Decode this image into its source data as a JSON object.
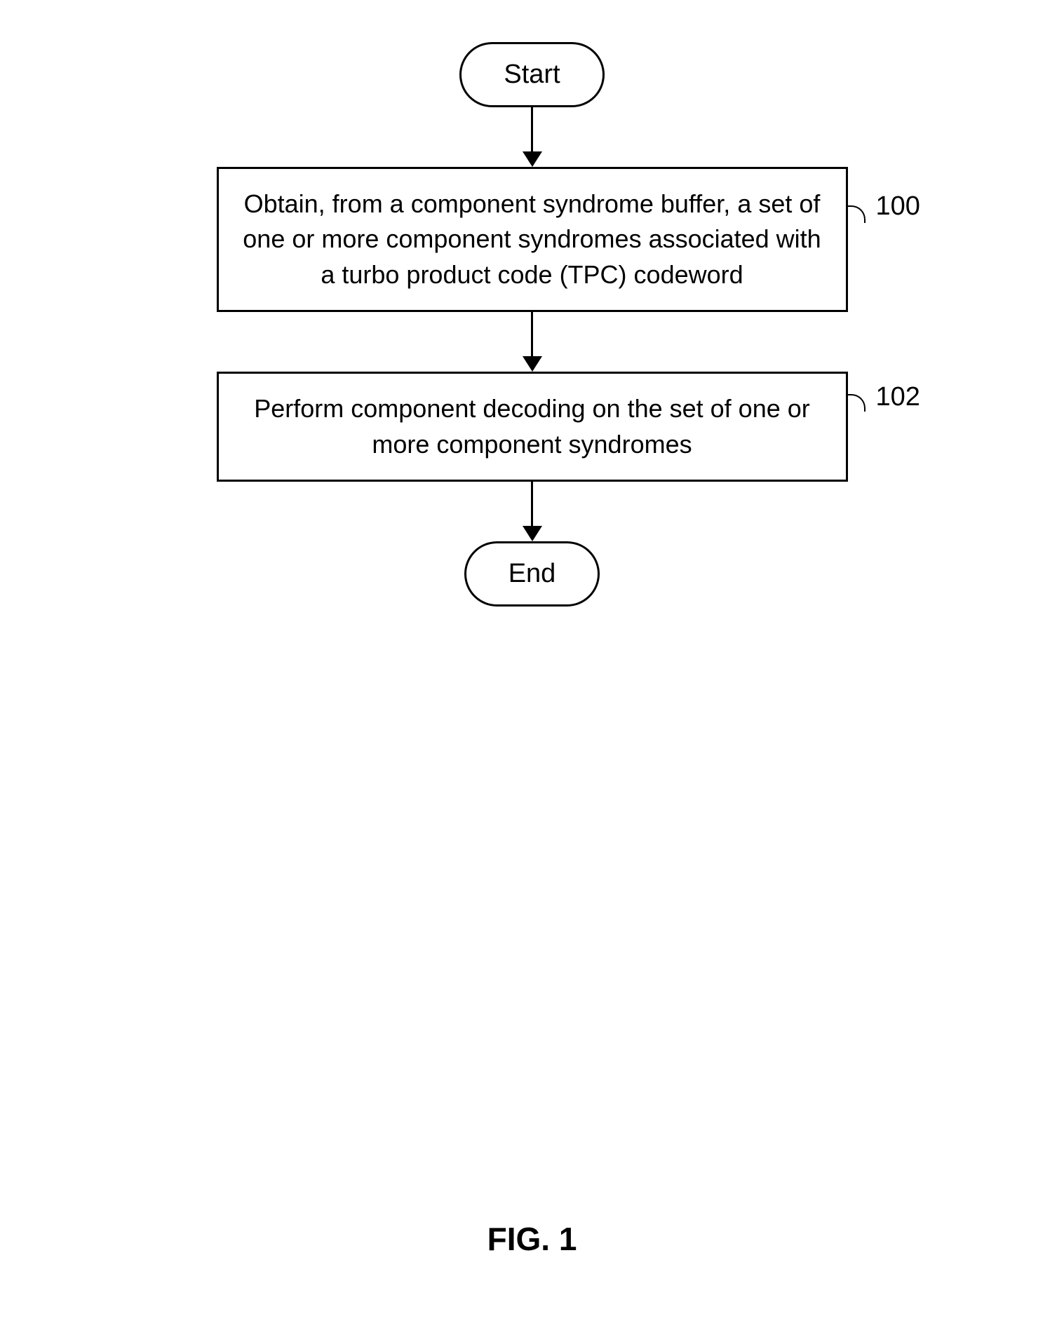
{
  "flowchart": {
    "start": "Start",
    "step1": "Obtain, from a component syndrome buffer, a set of one or more component syndromes associated with a turbo product code (TPC) codeword",
    "step2": "Perform component decoding on the set of one or more component syndromes",
    "end": "End",
    "ref1": "100",
    "ref2": "102"
  },
  "figure_label": "FIG. 1"
}
